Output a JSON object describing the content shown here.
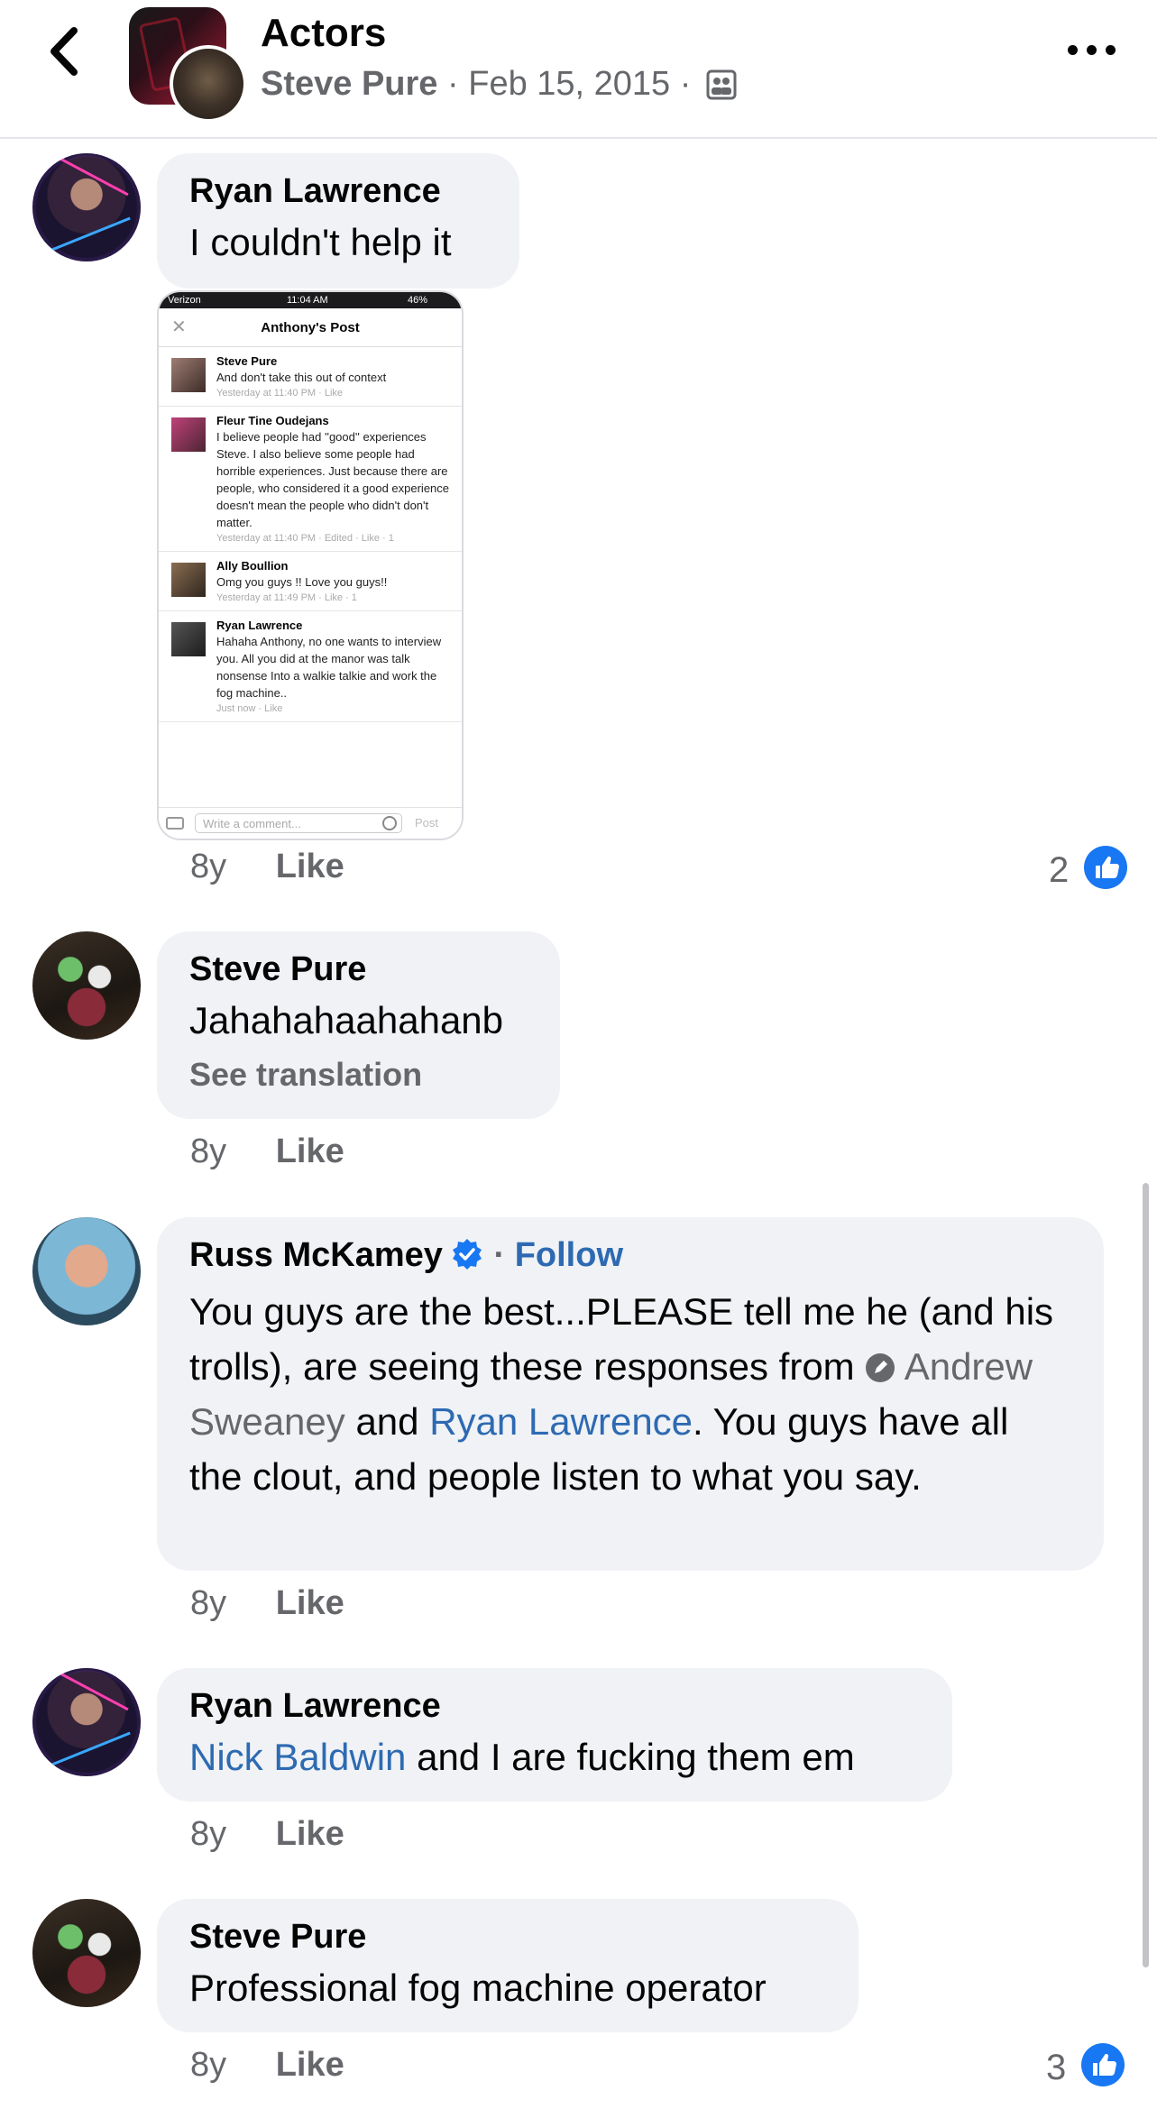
{
  "header": {
    "title": "Actors",
    "author": "Steve Pure",
    "separator": "·",
    "date": "Feb 15, 2015"
  },
  "comments": [
    {
      "author": "Ryan Lawrence",
      "text": "I couldn't help it",
      "age": "8y",
      "like_label": "Like",
      "reaction_count": "2",
      "attachment": {
        "status_carrier": "Verizon",
        "status_time": "11:04 AM",
        "status_battery": "46%",
        "title": "Anthony's Post",
        "comments": [
          {
            "name": "Steve Pure",
            "text": "And don't take this out of context",
            "meta": "Yesterday at 11:40 PM · Like"
          },
          {
            "name": "Fleur Tine Oudejans",
            "text": "I believe people had ''good'' experiences Steve. I also believe some people had horrible experiences. Just because there are people, who considered it a good experience doesn't mean the people who didn't don't matter.",
            "meta": "Yesterday at 11:40 PM · Edited · Like · 1"
          },
          {
            "name": "Ally Boullion",
            "text": "Omg you guys !! Love you guys!!",
            "meta": "Yesterday at 11:49 PM · Like · 1"
          },
          {
            "name": "Ryan Lawrence",
            "text": "Hahaha Anthony, no one wants to interview you. All you did at the manor was talk nonsense Into a walkie talkie and work the fog machine..",
            "meta": "Just now · Like"
          }
        ],
        "comment_placeholder": "Write a comment...",
        "post_label": "Post"
      }
    },
    {
      "author": "Steve Pure",
      "text": "Jahahahaahahanb",
      "see_translation": "See translation",
      "age": "8y",
      "like_label": "Like"
    },
    {
      "author": "Russ McKamey",
      "follow_label": "Follow",
      "text_part1": "You guys are the best...PLEASE tell me he (and his trolls), are seeing these responses from ",
      "mention1": "Andrew Sweaney",
      "text_part2": " and ",
      "mention2": "Ryan Lawrence",
      "text_part3": ". You guys have all the clout, and people listen to what you say.",
      "age": "8y",
      "like_label": "Like"
    },
    {
      "author": "Ryan Lawrence",
      "mention": "Nick Baldwin",
      "text": " and I are fucking them em",
      "age": "8y",
      "like_label": "Like"
    },
    {
      "author": "Steve Pure",
      "text": "Professional fog machine operator",
      "age": "8y",
      "like_label": "Like",
      "reaction_count": "3"
    }
  ],
  "colors": {
    "bubble": "#f0f2f5",
    "link": "#2d6ab2",
    "muted": "#65676b",
    "like_blue": "#1877f2"
  },
  "icons": [
    "back-chevron-icon",
    "group-members-icon",
    "more-options-icon",
    "like-reaction-icon",
    "verified-badge-icon",
    "pencil-icon"
  ]
}
